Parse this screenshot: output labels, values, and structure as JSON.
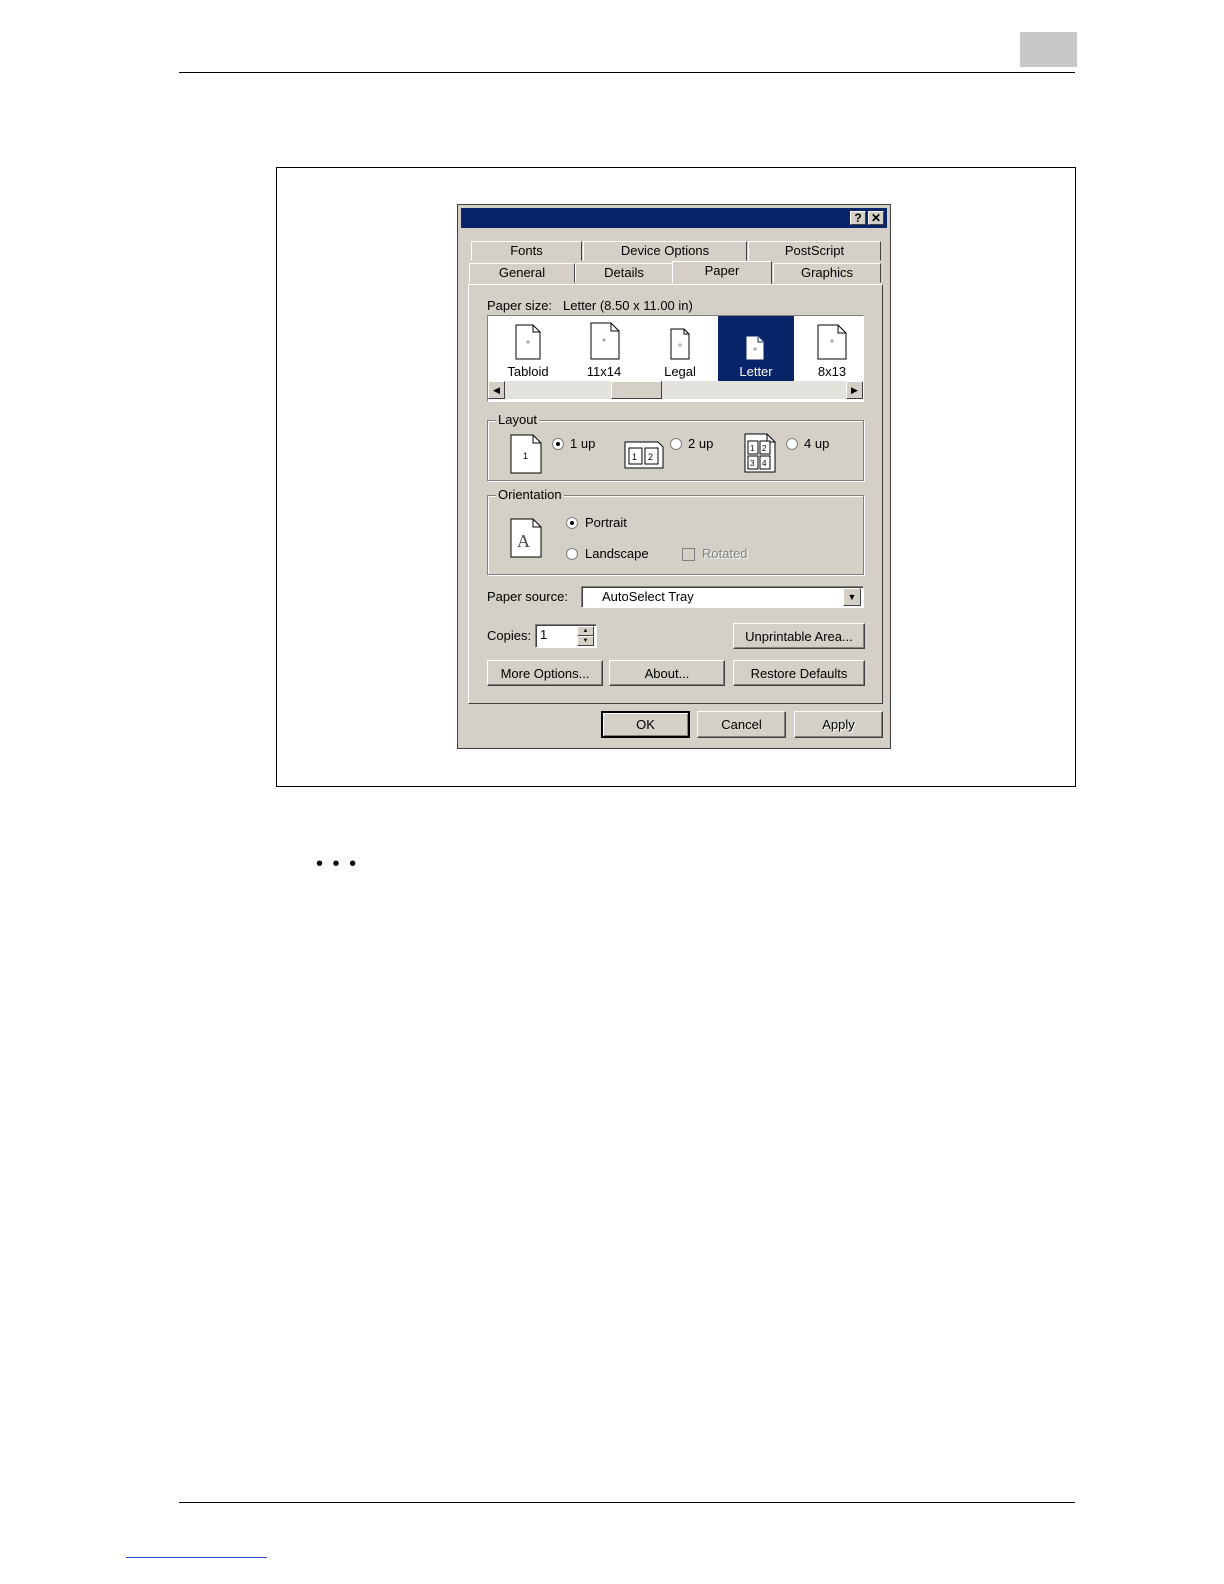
{
  "dialog": {
    "titlebar_buttons": {
      "help": "?",
      "close": "✕"
    },
    "tabs_back": [
      "Fonts",
      "Device Options",
      "PostScript"
    ],
    "tabs_front": [
      "General",
      "Details",
      "Paper",
      "Graphics"
    ],
    "active_tab": "Paper",
    "paper_size": {
      "label": "Paper size:",
      "value": "Letter (8.50 x 11.00 in)",
      "items": [
        "Tabloid",
        "11x14",
        "Legal",
        "Letter",
        "8x13"
      ],
      "selected": "Letter"
    },
    "layout": {
      "title": "Layout",
      "options": [
        "1 up",
        "2 up",
        "4 up"
      ],
      "icon_numbers": {
        "one": "1",
        "two": [
          "1",
          "2"
        ],
        "four": [
          "1",
          "2",
          "3",
          "4"
        ]
      },
      "selected": "1 up"
    },
    "orientation": {
      "title": "Orientation",
      "icon_letter": "A",
      "portrait": "Portrait",
      "landscape": "Landscape",
      "rotated": "Rotated",
      "selected": "Portrait"
    },
    "paper_source": {
      "label": "Paper source:",
      "value": "AutoSelect Tray"
    },
    "copies": {
      "label": "Copies:",
      "value": "1"
    },
    "buttons": {
      "unprintable": "Unprintable Area...",
      "more_options": "More Options...",
      "about": "About...",
      "restore": "Restore Defaults",
      "ok": "OK",
      "cancel": "Cancel",
      "apply": "Apply"
    }
  },
  "page": {
    "ellipsis": "• • •"
  }
}
